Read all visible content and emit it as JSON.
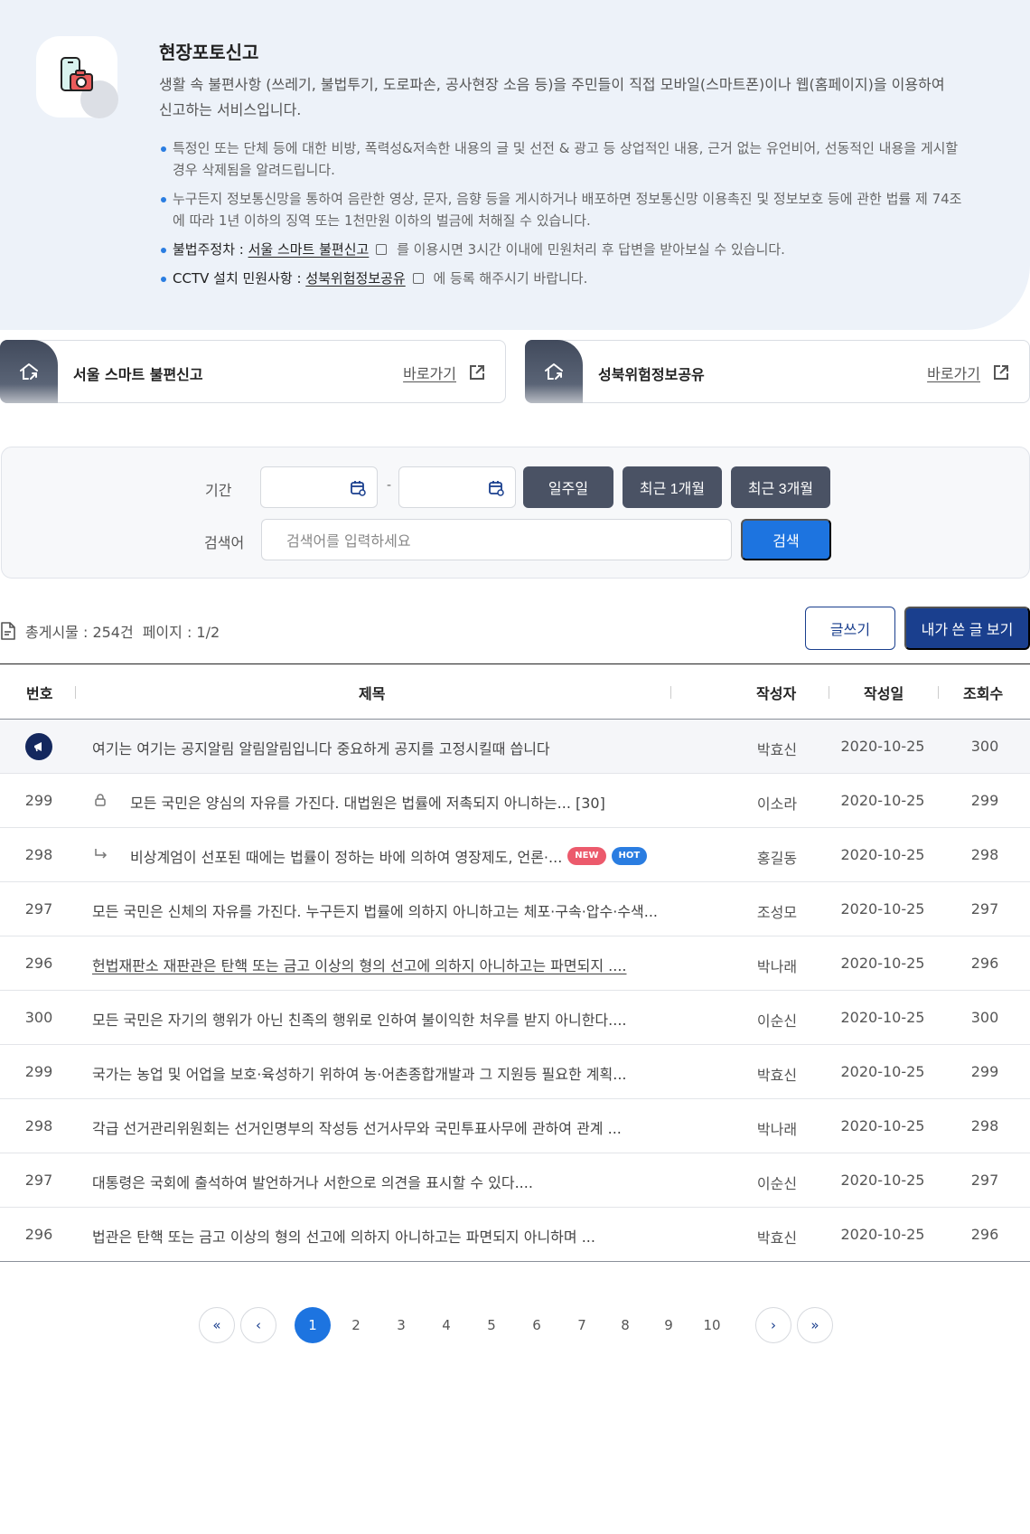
{
  "intro": {
    "title": "현장포토신고",
    "description": "생활 속 불편사항 (쓰레기, 불법투기, 도로파손, 공사현장 소음 등)을 주민들이 직접 모바일(스마트폰)이나 웹(홈페이지)을 이용하여 신고하는 서비스입니다.",
    "notice1": "특정인 또는 단체 등에 대한 비방, 폭력성&저속한 내용의 글 및 선전 & 광고 등 상업적인 내용, 근거 없는 유언비어, 선동적인 내용을 게시할 경우 삭제됨을 알려드립니다.",
    "notice2": "누구든지 정보통신망을 통하여 음란한 영상, 문자, 음향 등을 게시하거나 배포하면 정보통신망 이용촉진 및 정보보호 등에 관한 법률 제 74조에 따라 1년 이하의 징역 또는 1천만원 이하의 벌금에 처해질 수 있습니다.",
    "notice3_label": "불법주정차 : ",
    "notice3_link": "서울 스마트 불편신고",
    "notice3_rest": " 를 이용시면 3시간 이내에 민원처리 후 답변을 받아보실 수 있습니다.",
    "notice4_label": "CCTV 설치 민원사항 : ",
    "notice4_link": "성북위험정보공유",
    "notice4_rest": " 에 등록 해주시기 바랍니다."
  },
  "cards": [
    {
      "name": "서울 스마트 불편신고",
      "go": "바로가기"
    },
    {
      "name": "성북위험정보공유",
      "go": "바로가기"
    }
  ],
  "search": {
    "period_label": "기간",
    "date_sep": "-",
    "btn_week": "일주일",
    "btn_month": "최근 1개월",
    "btn_3month": "최근 3개월",
    "keyword_label": "검색어",
    "keyword_placeholder": "검색어를 입력하세요",
    "search_btn": "검색"
  },
  "summary": {
    "total": "총게시물 : 254건",
    "page": "페이지 : 1/2",
    "write_btn": "글쓰기",
    "my_btn": "내가 쓴 글 보기"
  },
  "table": {
    "headers": {
      "no": "번호",
      "title": "제목",
      "author": "작성자",
      "date": "작성일",
      "views": "조회수"
    },
    "notice": {
      "title": "여기는 여기는 공지알림 알림알림입니다 중요하게 공지를 고정시킬때 씁니다",
      "author": "박효신",
      "date": "2020-10-25",
      "views": "300"
    },
    "rows": [
      {
        "no": "299",
        "title": "모든 국민은 양심의 자유를 가진다. 대법원은 법률에 저촉되지 아니하는... [30]",
        "author": "이소라",
        "date": "2020-10-25",
        "views": "299"
      },
      {
        "no": "298",
        "title": "비상계엄이 선포된 때에는 법률이 정하는 바에 의하여 영장제도, 언론·...",
        "author": "홍길동",
        "date": "2020-10-25",
        "views": "298",
        "tag_new": "NEW",
        "tag_hot": "HOT"
      },
      {
        "no": "297",
        "title": "모든 국민은 신체의 자유를 가진다. 누구든지 법률에 의하지 아니하고는 체포·구속·압수·수색...",
        "author": "조성모",
        "date": "2020-10-25",
        "views": "297"
      },
      {
        "no": "296",
        "title": "헌법재판소 재판관은 탄핵 또는 금고 이상의 형의 선고에 의하지 아니하고는 파면되지 ....",
        "author": "박나래",
        "date": "2020-10-25",
        "views": "296"
      },
      {
        "no": "300",
        "title": "모든 국민은 자기의 행위가 아닌 친족의 행위로 인하여 불이익한 처우를 받지 아니한다....",
        "author": "이순신",
        "date": "2020-10-25",
        "views": "300"
      },
      {
        "no": "299",
        "title": "국가는 농업 및 어업을 보호·육성하기 위하여 농·어촌종합개발과 그 지원등 필요한 계획...",
        "author": "박효신",
        "date": "2020-10-25",
        "views": "299"
      },
      {
        "no": "298",
        "title": "각급 선거관리위원회는 선거인명부의 작성등 선거사무와 국민투표사무에 관하여 관계 ...",
        "author": "박나래",
        "date": "2020-10-25",
        "views": "298"
      },
      {
        "no": "297",
        "title": "대통령은 국회에 출석하여 발언하거나 서한으로 의견을 표시할 수 있다....",
        "author": "이순신",
        "date": "2020-10-25",
        "views": "297"
      },
      {
        "no": "296",
        "title": "법관은 탄핵 또는 금고 이상의 형의 선고에 의하지 아니하고는 파면되지 아니하며  ...",
        "author": "박효신",
        "date": "2020-10-25",
        "views": "296"
      }
    ]
  },
  "pagination": {
    "first": "«",
    "prev": "‹",
    "pages": [
      "1",
      "2",
      "3",
      "4",
      "5",
      "6",
      "7",
      "8",
      "9",
      "10"
    ],
    "next": "›",
    "last": "»"
  },
  "colors": {
    "primary": "#1d74e0",
    "navy": "#1a3f8e",
    "dark_button": "#4a5264",
    "info_bg": "#edf2f9"
  }
}
